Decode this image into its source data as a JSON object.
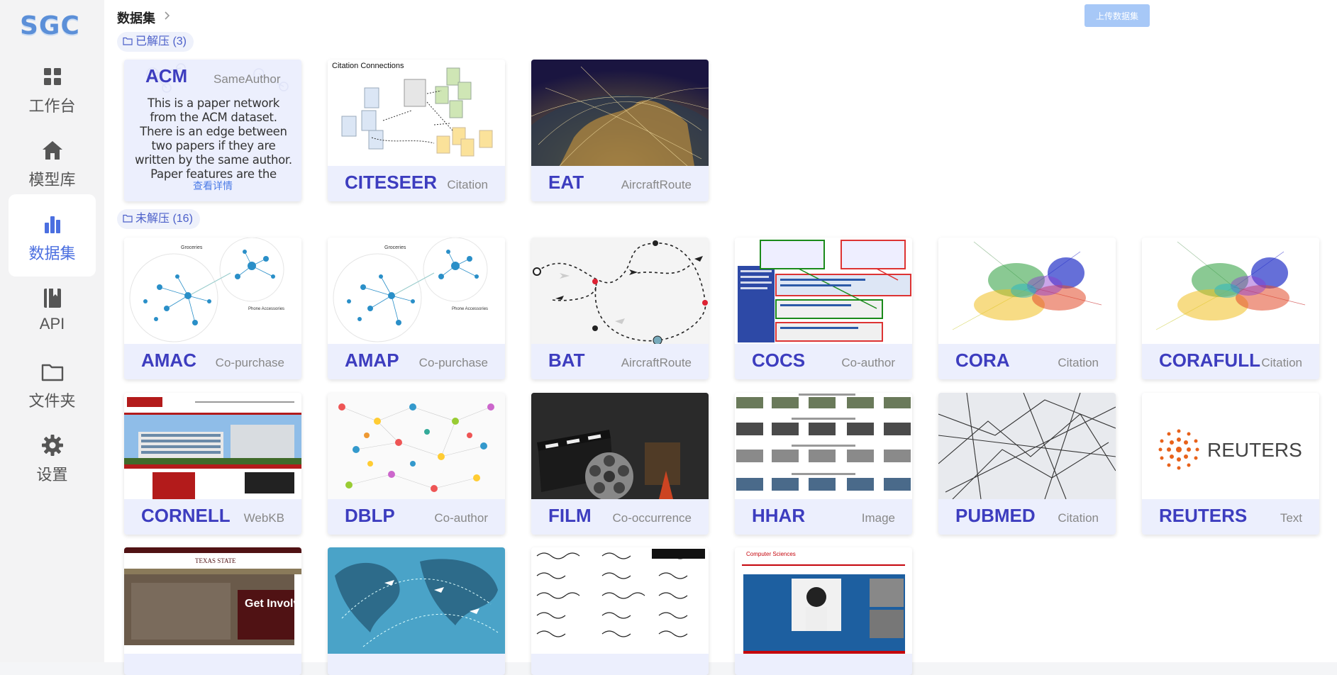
{
  "logo": "SGC",
  "nav": [
    {
      "label": "工作台",
      "icon": "dashboard-icon"
    },
    {
      "label": "模型库",
      "icon": "home-icon"
    },
    {
      "label": "数据集",
      "icon": "bar-chart-icon",
      "active": true
    },
    {
      "label": "API",
      "icon": "book-icon"
    },
    {
      "label": "文件夹",
      "icon": "folder-icon"
    },
    {
      "label": "设置",
      "icon": "gear-icon"
    }
  ],
  "breadcrumb": "数据集",
  "upload_button": "上传数据集",
  "sections": {
    "unzipped": "已解压 (3)",
    "zipped": "未解压 (16)"
  },
  "acm": {
    "name": "ACM",
    "type": "SameAuthor",
    "description": "This is a paper network from the ACM dataset. There is an edge between two papers if they are written by the same author. Paper features are the",
    "link": "查看详情"
  },
  "unzipped_cards": [
    {
      "name": "CITESEER",
      "type": "Citation",
      "thumb_text": "Citation Connections"
    },
    {
      "name": "EAT",
      "type": "AircraftRoute"
    }
  ],
  "zipped_cards": [
    {
      "name": "AMAC",
      "type": "Co-purchase"
    },
    {
      "name": "AMAP",
      "type": "Co-purchase"
    },
    {
      "name": "BAT",
      "type": "AircraftRoute"
    },
    {
      "name": "COCS",
      "type": "Co-author"
    },
    {
      "name": "CORA",
      "type": "Citation"
    },
    {
      "name": "CORAFULL",
      "type": "Citation"
    },
    {
      "name": "CORNELL",
      "type": "WebKB"
    },
    {
      "name": "DBLP",
      "type": "Co-author"
    },
    {
      "name": "FILM",
      "type": "Co-occurrence"
    },
    {
      "name": "HHAR",
      "type": "Image"
    },
    {
      "name": "PUBMED",
      "type": "Citation"
    },
    {
      "name": "REUTERS",
      "type": "Text"
    }
  ],
  "thumb_labels": {
    "groceries": "Groceries",
    "phone_accessories": "Phone Accessories",
    "reuters_logo": "REUTERS",
    "get_involved": "Get Involved!",
    "computer_sciences": "Computer Sciences",
    "texas_state": "TEXAS STATE"
  }
}
